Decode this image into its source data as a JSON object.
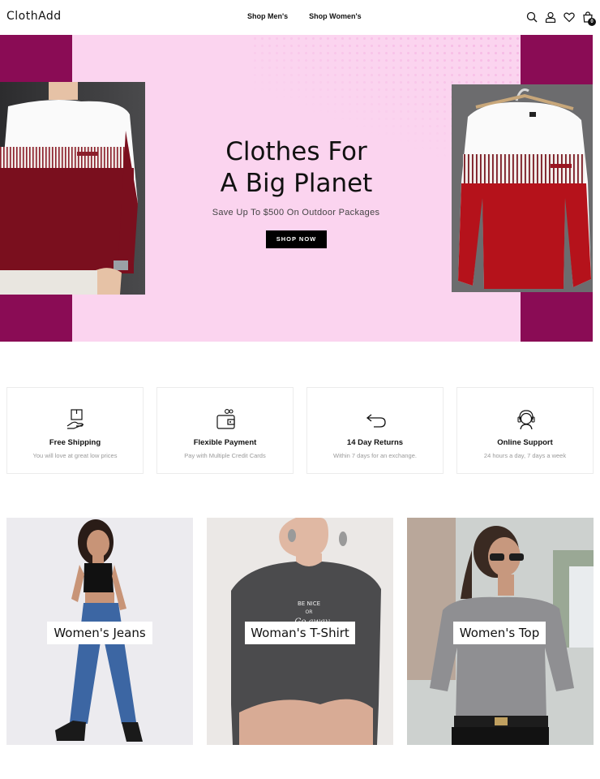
{
  "header": {
    "logo": "ClothAdd",
    "nav": [
      "Shop Men's",
      "Shop Women's"
    ],
    "icons": [
      "search-icon",
      "user-icon",
      "heart-icon",
      "bag-icon"
    ],
    "cart_count": "0"
  },
  "hero": {
    "title_line1": "Clothes For",
    "title_line2": "A Big Planet",
    "subtitle": "Save Up To $500 On Outdoor Packages",
    "button": "SHOP NOW",
    "colors": {
      "background": "#fbd4ef",
      "accent": "#8a0c55"
    }
  },
  "features": [
    {
      "title": "Free Shipping",
      "desc": "You will love at great low prices",
      "icon": "box-hand-icon"
    },
    {
      "title": "Flexible Payment",
      "desc": "Pay with Multiple Credit Cards",
      "icon": "wallet-icon"
    },
    {
      "title": "14 Day Returns",
      "desc": "Within 7 days for an exchange.",
      "icon": "return-arrow-icon"
    },
    {
      "title": "Online Support",
      "desc": "24 hours a day, 7 days a week",
      "icon": "support-agent-icon"
    }
  ],
  "categories": [
    {
      "label": "Women's Jeans"
    },
    {
      "label": "Woman's T-Shirt"
    },
    {
      "label": "Women's Top"
    }
  ]
}
